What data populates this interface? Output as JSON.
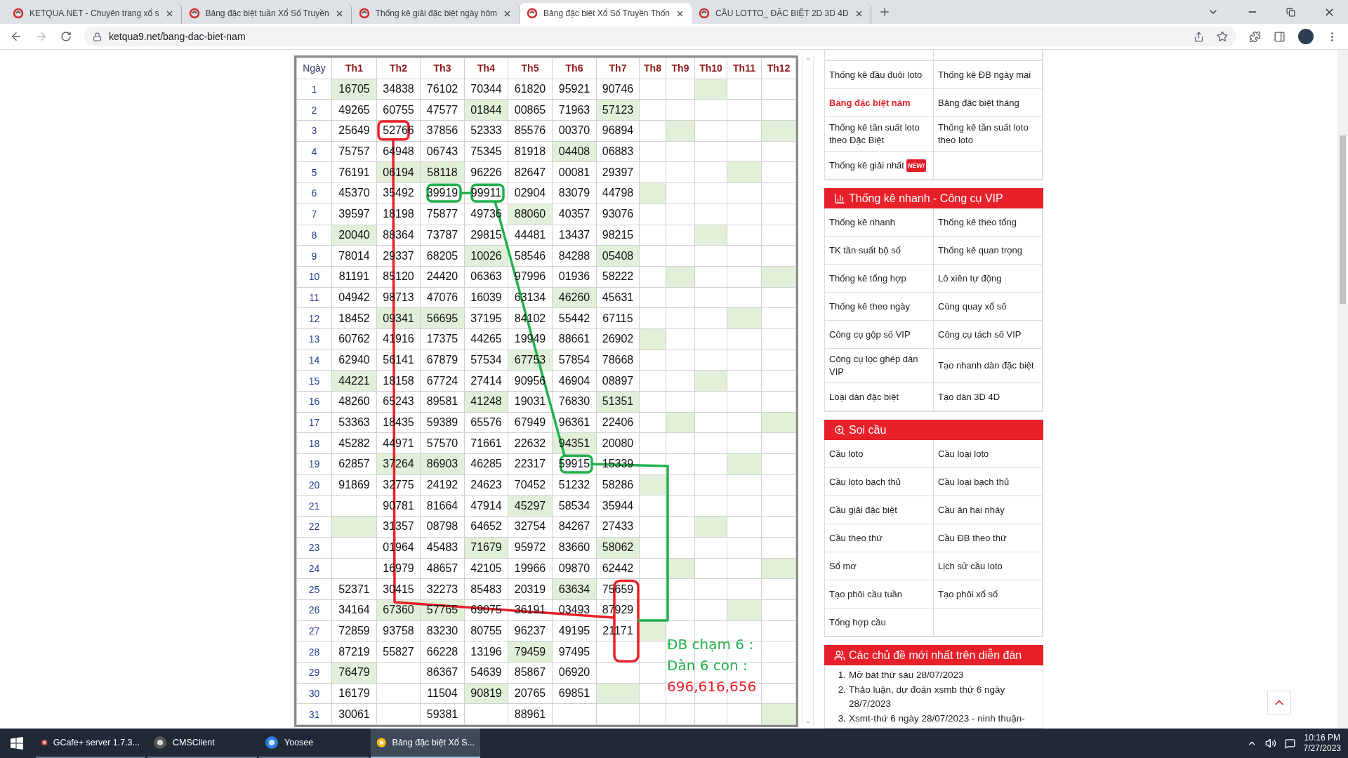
{
  "browser": {
    "tabs": [
      {
        "title": "KETQUA.NET - Chuyên trang xổ s",
        "selected": false
      },
      {
        "title": "Bảng đặc biệt tuần Xổ Số Truyền",
        "selected": false
      },
      {
        "title": "Thống kê giải đặc biệt ngày hôm",
        "selected": false
      },
      {
        "title": "Bảng đặc biệt Xổ Số Truyền Thốn",
        "selected": true
      },
      {
        "title": "CẦU LOTTO_ ĐẶC BIỆT 2D 3D 4D",
        "selected": false
      }
    ],
    "address": "ketqua9.net/bang-dac-biet-nam"
  },
  "table": {
    "day_header": "Ngày",
    "columns": [
      "Th1",
      "Th2",
      "Th3",
      "Th4",
      "Th5",
      "Th6",
      "Th7",
      "Th8",
      "Th9",
      "Th10",
      "Th11",
      "Th12"
    ],
    "rows": [
      {
        "day": "1",
        "cells": [
          {
            "value": "16705",
            "highlighted": true
          },
          {
            "value": "34838",
            "highlighted": false
          },
          {
            "value": "76102",
            "highlighted": false
          },
          {
            "value": "70344",
            "highlighted": false
          },
          {
            "value": "61820",
            "highlighted": false
          },
          {
            "value": "95921",
            "highlighted": false
          },
          {
            "value": "90746",
            "highlighted": false
          },
          {
            "highlighted": false
          },
          {
            "highlighted": false
          },
          {
            "highlighted": true
          },
          {
            "highlighted": false
          },
          {
            "highlighted": false
          }
        ]
      },
      {
        "day": "2",
        "cells": [
          {
            "value": "49265",
            "highlighted": false
          },
          {
            "value": "60755",
            "highlighted": false
          },
          {
            "value": "47577",
            "highlighted": false
          },
          {
            "value": "01844",
            "highlighted": true
          },
          {
            "value": "00865",
            "highlighted": false
          },
          {
            "value": "71963",
            "highlighted": false
          },
          {
            "value": "57123",
            "highlighted": true
          },
          {
            "highlighted": false
          },
          {
            "highlighted": false
          },
          {
            "highlighted": false
          },
          {
            "highlighted": false
          },
          {
            "highlighted": false
          }
        ]
      },
      {
        "day": "3",
        "cells": [
          {
            "value": "25649",
            "highlighted": false
          },
          {
            "value": "52766",
            "highlighted": false
          },
          {
            "value": "37856",
            "highlighted": false
          },
          {
            "value": "52333",
            "highlighted": false
          },
          {
            "value": "85576",
            "highlighted": false
          },
          {
            "value": "00370",
            "highlighted": false
          },
          {
            "value": "96894",
            "highlighted": false
          },
          {
            "highlighted": false
          },
          {
            "highlighted": true
          },
          {
            "highlighted": false
          },
          {
            "highlighted": false
          },
          {
            "highlighted": true
          }
        ]
      },
      {
        "day": "4",
        "cells": [
          {
            "value": "75757",
            "highlighted": false
          },
          {
            "value": "64948",
            "highlighted": false
          },
          {
            "value": "06743",
            "highlighted": false
          },
          {
            "value": "75345",
            "highlighted": false
          },
          {
            "value": "81918",
            "highlighted": false
          },
          {
            "value": "04408",
            "highlighted": true
          },
          {
            "value": "06883",
            "highlighted": false
          },
          {
            "highlighted": false
          },
          {
            "highlighted": false
          },
          {
            "highlighted": false
          },
          {
            "highlighted": false
          },
          {
            "highlighted": false
          }
        ]
      },
      {
        "day": "5",
        "cells": [
          {
            "value": "76191",
            "highlighted": false
          },
          {
            "value": "06194",
            "highlighted": true
          },
          {
            "value": "58118",
            "highlighted": true
          },
          {
            "value": "96226",
            "highlighted": false
          },
          {
            "value": "82647",
            "highlighted": false
          },
          {
            "value": "00081",
            "highlighted": false
          },
          {
            "value": "29397",
            "highlighted": false
          },
          {
            "highlighted": false
          },
          {
            "highlighted": false
          },
          {
            "highlighted": false
          },
          {
            "highlighted": true
          },
          {
            "highlighted": false
          }
        ]
      },
      {
        "day": "6",
        "cells": [
          {
            "value": "45370",
            "highlighted": false
          },
          {
            "value": "35492",
            "highlighted": false
          },
          {
            "value": "39919",
            "highlighted": false
          },
          {
            "value": "99911",
            "highlighted": false
          },
          {
            "value": "02904",
            "highlighted": false
          },
          {
            "value": "83079",
            "highlighted": false
          },
          {
            "value": "44798",
            "highlighted": false
          },
          {
            "highlighted": true
          },
          {
            "highlighted": false
          },
          {
            "highlighted": false
          },
          {
            "highlighted": false
          },
          {
            "highlighted": false
          }
        ]
      },
      {
        "day": "7",
        "cells": [
          {
            "value": "39597",
            "highlighted": false
          },
          {
            "value": "18198",
            "highlighted": false
          },
          {
            "value": "75877",
            "highlighted": false
          },
          {
            "value": "49736",
            "highlighted": false
          },
          {
            "value": "88060",
            "highlighted": true
          },
          {
            "value": "40357",
            "highlighted": false
          },
          {
            "value": "93076",
            "highlighted": false
          },
          {
            "highlighted": false
          },
          {
            "highlighted": false
          },
          {
            "highlighted": false
          },
          {
            "highlighted": false
          },
          {
            "highlighted": false
          }
        ]
      },
      {
        "day": "8",
        "cells": [
          {
            "value": "20040",
            "highlighted": true
          },
          {
            "value": "88364",
            "highlighted": false
          },
          {
            "value": "73787",
            "highlighted": false
          },
          {
            "value": "29815",
            "highlighted": false
          },
          {
            "value": "44481",
            "highlighted": false
          },
          {
            "value": "13437",
            "highlighted": false
          },
          {
            "value": "98215",
            "highlighted": false
          },
          {
            "highlighted": false
          },
          {
            "highlighted": false
          },
          {
            "highlighted": true
          },
          {
            "highlighted": false
          },
          {
            "highlighted": false
          }
        ]
      },
      {
        "day": "9",
        "cells": [
          {
            "value": "78014",
            "highlighted": false
          },
          {
            "value": "29337",
            "highlighted": false
          },
          {
            "value": "68205",
            "highlighted": false
          },
          {
            "value": "10026",
            "highlighted": true
          },
          {
            "value": "58546",
            "highlighted": false
          },
          {
            "value": "84288",
            "highlighted": false
          },
          {
            "value": "05408",
            "highlighted": true
          },
          {
            "highlighted": false
          },
          {
            "highlighted": false
          },
          {
            "highlighted": false
          },
          {
            "highlighted": false
          },
          {
            "highlighted": false
          }
        ]
      },
      {
        "day": "10",
        "cells": [
          {
            "value": "81191",
            "highlighted": false
          },
          {
            "value": "85120",
            "highlighted": false
          },
          {
            "value": "24420",
            "highlighted": false
          },
          {
            "value": "06363",
            "highlighted": false
          },
          {
            "value": "97996",
            "highlighted": false
          },
          {
            "value": "01936",
            "highlighted": false
          },
          {
            "value": "58222",
            "highlighted": false
          },
          {
            "highlighted": false
          },
          {
            "highlighted": true
          },
          {
            "highlighted": false
          },
          {
            "highlighted": false
          },
          {
            "highlighted": true
          }
        ]
      },
      {
        "day": "11",
        "cells": [
          {
            "value": "04942",
            "highlighted": false
          },
          {
            "value": "98713",
            "highlighted": false
          },
          {
            "value": "47076",
            "highlighted": false
          },
          {
            "value": "16039",
            "highlighted": false
          },
          {
            "value": "63134",
            "highlighted": false
          },
          {
            "value": "46260",
            "highlighted": true
          },
          {
            "value": "45631",
            "highlighted": false
          },
          {
            "highlighted": false
          },
          {
            "highlighted": false
          },
          {
            "highlighted": false
          },
          {
            "highlighted": false
          },
          {
            "highlighted": false
          }
        ]
      },
      {
        "day": "12",
        "cells": [
          {
            "value": "18452",
            "highlighted": false
          },
          {
            "value": "09341",
            "highlighted": true
          },
          {
            "value": "56695",
            "highlighted": true
          },
          {
            "value": "37195",
            "highlighted": false
          },
          {
            "value": "84102",
            "highlighted": false
          },
          {
            "value": "55442",
            "highlighted": false
          },
          {
            "value": "67115",
            "highlighted": false
          },
          {
            "highlighted": false
          },
          {
            "highlighted": false
          },
          {
            "highlighted": false
          },
          {
            "highlighted": true
          },
          {
            "highlighted": false
          }
        ]
      },
      {
        "day": "13",
        "cells": [
          {
            "value": "60762",
            "highlighted": false
          },
          {
            "value": "41916",
            "highlighted": false
          },
          {
            "value": "17375",
            "highlighted": false
          },
          {
            "value": "44265",
            "highlighted": false
          },
          {
            "value": "19949",
            "highlighted": false
          },
          {
            "value": "88661",
            "highlighted": false
          },
          {
            "value": "26902",
            "highlighted": false
          },
          {
            "highlighted": true
          },
          {
            "highlighted": false
          },
          {
            "highlighted": false
          },
          {
            "highlighted": false
          },
          {
            "highlighted": false
          }
        ]
      },
      {
        "day": "14",
        "cells": [
          {
            "value": "62940",
            "highlighted": false
          },
          {
            "value": "56141",
            "highlighted": false
          },
          {
            "value": "67879",
            "highlighted": false
          },
          {
            "value": "57534",
            "highlighted": false
          },
          {
            "value": "67753",
            "highlighted": true
          },
          {
            "value": "57854",
            "highlighted": false
          },
          {
            "value": "78668",
            "highlighted": false
          },
          {
            "highlighted": false
          },
          {
            "highlighted": false
          },
          {
            "highlighted": false
          },
          {
            "highlighted": false
          },
          {
            "highlighted": false
          }
        ]
      },
      {
        "day": "15",
        "cells": [
          {
            "value": "44221",
            "highlighted": true
          },
          {
            "value": "18158",
            "highlighted": false
          },
          {
            "value": "67724",
            "highlighted": false
          },
          {
            "value": "27414",
            "highlighted": false
          },
          {
            "value": "90956",
            "highlighted": false
          },
          {
            "value": "46904",
            "highlighted": false
          },
          {
            "value": "08897",
            "highlighted": false
          },
          {
            "highlighted": false
          },
          {
            "highlighted": false
          },
          {
            "highlighted": true
          },
          {
            "highlighted": false
          },
          {
            "highlighted": false
          }
        ]
      },
      {
        "day": "16",
        "cells": [
          {
            "value": "48260",
            "highlighted": false
          },
          {
            "value": "65243",
            "highlighted": false
          },
          {
            "value": "89581",
            "highlighted": false
          },
          {
            "value": "41248",
            "highlighted": true
          },
          {
            "value": "19031",
            "highlighted": false
          },
          {
            "value": "76830",
            "highlighted": false
          },
          {
            "value": "51351",
            "highlighted": true
          },
          {
            "highlighted": false
          },
          {
            "highlighted": false
          },
          {
            "highlighted": false
          },
          {
            "highlighted": false
          },
          {
            "highlighted": false
          }
        ]
      },
      {
        "day": "17",
        "cells": [
          {
            "value": "53363",
            "highlighted": false
          },
          {
            "value": "18435",
            "highlighted": false
          },
          {
            "value": "59389",
            "highlighted": false
          },
          {
            "value": "65576",
            "highlighted": false
          },
          {
            "value": "67949",
            "highlighted": false
          },
          {
            "value": "96361",
            "highlighted": false
          },
          {
            "value": "22406",
            "highlighted": false
          },
          {
            "highlighted": false
          },
          {
            "highlighted": true
          },
          {
            "highlighted": false
          },
          {
            "highlighted": false
          },
          {
            "highlighted": true
          }
        ]
      },
      {
        "day": "18",
        "cells": [
          {
            "value": "45282",
            "highlighted": false
          },
          {
            "value": "44971",
            "highlighted": false
          },
          {
            "value": "57570",
            "highlighted": false
          },
          {
            "value": "71661",
            "highlighted": false
          },
          {
            "value": "22632",
            "highlighted": false
          },
          {
            "value": "94351",
            "highlighted": true
          },
          {
            "value": "20080",
            "highlighted": false
          },
          {
            "highlighted": false
          },
          {
            "highlighted": false
          },
          {
            "highlighted": false
          },
          {
            "highlighted": false
          },
          {
            "highlighted": false
          }
        ]
      },
      {
        "day": "19",
        "cells": [
          {
            "value": "62857",
            "highlighted": false
          },
          {
            "value": "37264",
            "highlighted": true
          },
          {
            "value": "86903",
            "highlighted": true
          },
          {
            "value": "46285",
            "highlighted": false
          },
          {
            "value": "22317",
            "highlighted": false
          },
          {
            "value": "59915",
            "highlighted": false
          },
          {
            "value": "15339",
            "highlighted": false
          },
          {
            "highlighted": false
          },
          {
            "highlighted": false
          },
          {
            "highlighted": false
          },
          {
            "highlighted": true
          },
          {
            "highlighted": false
          }
        ]
      },
      {
        "day": "20",
        "cells": [
          {
            "value": "91869",
            "highlighted": false
          },
          {
            "value": "32775",
            "highlighted": false
          },
          {
            "value": "24192",
            "highlighted": false
          },
          {
            "value": "24623",
            "highlighted": false
          },
          {
            "value": "70452",
            "highlighted": false
          },
          {
            "value": "51232",
            "highlighted": false
          },
          {
            "value": "58286",
            "highlighted": false
          },
          {
            "highlighted": true
          },
          {
            "highlighted": false
          },
          {
            "highlighted": false
          },
          {
            "highlighted": false
          },
          {
            "highlighted": false
          }
        ]
      },
      {
        "day": "21",
        "cells": [
          {
            "highlighted": false
          },
          {
            "value": "90781",
            "highlighted": false
          },
          {
            "value": "81664",
            "highlighted": false
          },
          {
            "value": "47914",
            "highlighted": false
          },
          {
            "value": "45297",
            "highlighted": true
          },
          {
            "value": "58534",
            "highlighted": false
          },
          {
            "value": "35944",
            "highlighted": false
          },
          {
            "highlighted": false
          },
          {
            "highlighted": false
          },
          {
            "highlighted": false
          },
          {
            "highlighted": false
          },
          {
            "highlighted": false
          }
        ]
      },
      {
        "day": "22",
        "cells": [
          {
            "highlighted": true
          },
          {
            "value": "31357",
            "highlighted": false
          },
          {
            "value": "08798",
            "highlighted": false
          },
          {
            "value": "64652",
            "highlighted": false
          },
          {
            "value": "32754",
            "highlighted": false
          },
          {
            "value": "84267",
            "highlighted": false
          },
          {
            "value": "27433",
            "highlighted": false
          },
          {
            "highlighted": false
          },
          {
            "highlighted": false
          },
          {
            "highlighted": true
          },
          {
            "highlighted": false
          },
          {
            "highlighted": false
          }
        ]
      },
      {
        "day": "23",
        "cells": [
          {
            "highlighted": false
          },
          {
            "value": "01964",
            "highlighted": false
          },
          {
            "value": "45483",
            "highlighted": false
          },
          {
            "value": "71679",
            "highlighted": true
          },
          {
            "value": "95972",
            "highlighted": false
          },
          {
            "value": "83660",
            "highlighted": false
          },
          {
            "value": "58062",
            "highlighted": true
          },
          {
            "highlighted": false
          },
          {
            "highlighted": false
          },
          {
            "highlighted": false
          },
          {
            "highlighted": false
          },
          {
            "highlighted": false
          }
        ]
      },
      {
        "day": "24",
        "cells": [
          {
            "highlighted": false
          },
          {
            "value": "16979",
            "highlighted": false
          },
          {
            "value": "48657",
            "highlighted": false
          },
          {
            "value": "42105",
            "highlighted": false
          },
          {
            "value": "19966",
            "highlighted": false
          },
          {
            "value": "09870",
            "highlighted": false
          },
          {
            "value": "62442",
            "highlighted": false
          },
          {
            "highlighted": false
          },
          {
            "highlighted": true
          },
          {
            "highlighted": false
          },
          {
            "highlighted": false
          },
          {
            "highlighted": true
          }
        ]
      },
      {
        "day": "25",
        "cells": [
          {
            "value": "52371",
            "highlighted": false
          },
          {
            "value": "30415",
            "highlighted": false
          },
          {
            "value": "32273",
            "highlighted": false
          },
          {
            "value": "85483",
            "highlighted": false
          },
          {
            "value": "20319",
            "highlighted": false
          },
          {
            "value": "63634",
            "highlighted": true
          },
          {
            "value": "75659",
            "highlighted": false
          },
          {
            "highlighted": false
          },
          {
            "highlighted": false
          },
          {
            "highlighted": false
          },
          {
            "highlighted": false
          },
          {
            "highlighted": false
          }
        ]
      },
      {
        "day": "26",
        "cells": [
          {
            "value": "34164",
            "highlighted": false
          },
          {
            "value": "67360",
            "highlighted": true
          },
          {
            "value": "57765",
            "highlighted": true
          },
          {
            "value": "69075",
            "highlighted": false
          },
          {
            "value": "36191",
            "highlighted": false
          },
          {
            "value": "03493",
            "highlighted": false
          },
          {
            "value": "87929",
            "highlighted": false
          },
          {
            "highlighted": false
          },
          {
            "highlighted": false
          },
          {
            "highlighted": false
          },
          {
            "highlighted": true
          },
          {
            "highlighted": false
          }
        ]
      },
      {
        "day": "27",
        "cells": [
          {
            "value": "72859",
            "highlighted": false
          },
          {
            "value": "93758",
            "highlighted": false
          },
          {
            "value": "83230",
            "highlighted": false
          },
          {
            "value": "80755",
            "highlighted": false
          },
          {
            "value": "96237",
            "highlighted": false
          },
          {
            "value": "49195",
            "highlighted": false
          },
          {
            "value": "21171",
            "highlighted": false
          },
          {
            "highlighted": true
          },
          {
            "highlighted": false
          },
          {
            "highlighted": false
          },
          {
            "highlighted": false
          },
          {
            "highlighted": false
          }
        ]
      },
      {
        "day": "28",
        "cells": [
          {
            "value": "87219",
            "highlighted": false
          },
          {
            "value": "55827",
            "highlighted": false
          },
          {
            "value": "66228",
            "highlighted": false
          },
          {
            "value": "13196",
            "highlighted": false
          },
          {
            "value": "79459",
            "highlighted": true
          },
          {
            "value": "97495",
            "highlighted": false
          },
          {
            "highlighted": false
          },
          {
            "highlighted": false
          },
          {
            "highlighted": false
          },
          {
            "highlighted": false
          },
          {
            "highlighted": false
          },
          {
            "highlighted": false
          }
        ]
      },
      {
        "day": "29",
        "cells": [
          {
            "value": "76479",
            "highlighted": true
          },
          {
            "highlighted": false
          },
          {
            "value": "86367",
            "highlighted": false
          },
          {
            "value": "54639",
            "highlighted": false
          },
          {
            "value": "85867",
            "highlighted": false
          },
          {
            "value": "06920",
            "highlighted": false
          },
          {
            "highlighted": false
          },
          {
            "highlighted": false
          },
          {
            "highlighted": false
          },
          {
            "highlighted": false
          },
          {
            "highlighted": false
          },
          {
            "highlighted": false
          }
        ]
      },
      {
        "day": "30",
        "cells": [
          {
            "value": "16179",
            "highlighted": false
          },
          {
            "highlighted": false
          },
          {
            "value": "11504",
            "highlighted": false
          },
          {
            "value": "90819",
            "highlighted": true
          },
          {
            "value": "20765",
            "highlighted": false
          },
          {
            "value": "69851",
            "highlighted": false
          },
          {
            "highlighted": true
          },
          {
            "highlighted": false
          },
          {
            "highlighted": false
          },
          {
            "highlighted": false
          },
          {
            "highlighted": false
          },
          {
            "highlighted": false
          }
        ]
      },
      {
        "day": "31",
        "cells": [
          {
            "value": "30061",
            "highlighted": false
          },
          {
            "highlighted": false
          },
          {
            "value": "59381",
            "highlighted": false
          },
          {
            "highlighted": false
          },
          {
            "value": "88961",
            "highlighted": false
          },
          {
            "highlighted": false
          },
          {
            "highlighted": false
          },
          {
            "highlighted": false
          },
          {
            "highlighted": false
          },
          {
            "highlighted": false
          },
          {
            "highlighted": false
          },
          {
            "highlighted": true
          }
        ]
      }
    ]
  },
  "annotation": {
    "lines": [
      {
        "text": "ĐB chạm 6 :",
        "color": "#22b14c"
      },
      {
        "text": "Dàn 6 con :",
        "color": "#22b14c"
      },
      {
        "text": "696,616,656",
        "color": "#e8202a"
      }
    ]
  },
  "sidebar": {
    "sections": [
      {
        "links": [
          {
            "text": "Thống kê đầu đuôi loto",
            "selected": false
          },
          {
            "text": "Thống kê ĐB ngày mai",
            "selected": false
          },
          {
            "text": "Bảng đặc biệt năm",
            "selected": true
          },
          {
            "text": "Bảng đặc biệt tháng",
            "selected": false
          },
          {
            "text": "Thống kê tần suất loto theo Đặc Biệt",
            "selected": false
          },
          {
            "text": "Thống kê tần suất loto theo loto",
            "selected": false
          },
          {
            "text": "Thống kê giải nhất",
            "selected": false,
            "badge": "NEW!"
          }
        ]
      },
      {
        "title": "Thống kê nhanh - Công cụ VIP",
        "links": [
          {
            "text": "Thống kê nhanh",
            "selected": false
          },
          {
            "text": "Thống kê theo tổng",
            "selected": false
          },
          {
            "text": "TK tần suất bộ số",
            "selected": false
          },
          {
            "text": "Thống kê quan trọng",
            "selected": false
          },
          {
            "text": "Thống kê tổng hợp",
            "selected": false
          },
          {
            "text": "Lô xiên tự động",
            "selected": false
          },
          {
            "text": "Thống kê theo ngày",
            "selected": false
          },
          {
            "text": "Cùng quay xổ số",
            "selected": false
          },
          {
            "text": "Công cụ gộp số VIP",
            "selected": false
          },
          {
            "text": "Công cụ tách số VIP",
            "selected": false
          },
          {
            "text": "Công cụ lọc ghép dàn VIP",
            "selected": false
          },
          {
            "text": "Tạo nhanh dàn đặc biệt",
            "selected": false
          },
          {
            "text": "Loại dàn đặc biệt",
            "selected": false
          },
          {
            "text": "Tạo dàn 3D 4D",
            "selected": false
          }
        ]
      },
      {
        "title": "Soi cầu",
        "links": [
          {
            "text": "Cầu loto",
            "selected": false
          },
          {
            "text": "Cầu loại loto",
            "selected": false
          },
          {
            "text": "Cầu loto bạch thủ",
            "selected": false
          },
          {
            "text": "Cầu loại bạch thủ",
            "selected": false
          },
          {
            "text": "Cầu giải đặc biệt",
            "selected": false
          },
          {
            "text": "Cầu ăn hai nháy",
            "selected": false
          },
          {
            "text": "Cầu theo thứ",
            "selected": false
          },
          {
            "text": "Cầu ĐB theo thứ",
            "selected": false
          },
          {
            "text": "Sổ mơ",
            "selected": false
          },
          {
            "text": "Lịch sử cầu loto",
            "selected": false
          },
          {
            "text": "Tạo phôi cầu tuần",
            "selected": false
          },
          {
            "text": "Tạo phôi xổ số",
            "selected": false
          },
          {
            "text": "Tổng hợp cầu",
            "selected": false
          }
        ]
      }
    ],
    "forum": {
      "title": "Các chủ đề mới nhất trên diễn đàn",
      "topics": [
        {
          "number": "1.",
          "text": "Mở bát thứ sáu 28/07/2023"
        },
        {
          "number": "2.",
          "text": "Thảo luận, dự đoán xsmb thứ 6 ngày 28/7/2023"
        },
        {
          "number": "3.",
          "text": "Xsmt-thứ 6 ngày 28/07/2023 - ninh thuận-"
        }
      ]
    }
  },
  "taskbar": {
    "apps": [
      {
        "label": "GCafe+ server 1.7.3...",
        "active": false
      },
      {
        "label": "CMSClient",
        "active": false
      },
      {
        "label": "Yoosee",
        "active": false
      },
      {
        "label": "Bảng đặc biệt Xổ S...",
        "active": true
      }
    ],
    "time": "10:16 PM",
    "date": "7/27/2023"
  }
}
